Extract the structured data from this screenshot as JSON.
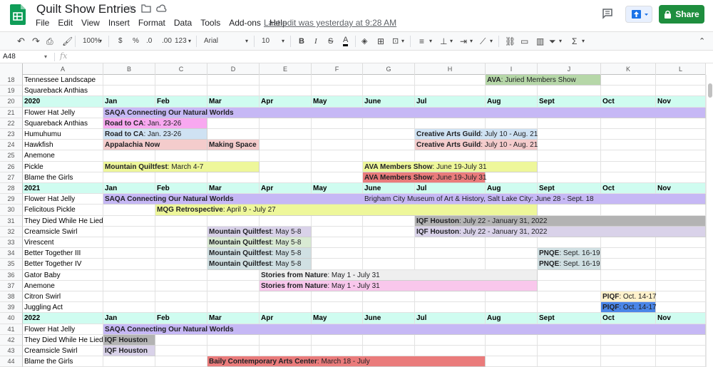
{
  "header": {
    "title": "Quilt Show Entries",
    "last_edit": "Last edit was yesterday at 9:28 AM",
    "share_label": "Share"
  },
  "menu": [
    "File",
    "Edit",
    "View",
    "Insert",
    "Format",
    "Data",
    "Tools",
    "Add-ons",
    "Help"
  ],
  "toolbar": {
    "zoom": "100%",
    "currency": "$",
    "percent": "%",
    "dec_decrease": ".0",
    "dec_increase": ".00",
    "format_more": "123",
    "font": "Arial",
    "font_size": "10",
    "bold": "B",
    "italic": "I",
    "strike": "S",
    "text_color": "A",
    "sigma": "Σ"
  },
  "formula_bar": {
    "cell_ref": "A48",
    "fx": "fx"
  },
  "columns": [
    "A",
    "B",
    "C",
    "D",
    "E",
    "F",
    "G",
    "H",
    "I",
    "J",
    "K",
    "L"
  ],
  "rows": [
    {
      "n": "18",
      "a": "Tennessee Landscape",
      "bands": [
        {
          "col": 8,
          "span": 2,
          "color": "#b6d7a8",
          "bold": "AVA",
          "text": ": Juried Members Show"
        }
      ]
    },
    {
      "n": "19",
      "a": "Squareback Anthias",
      "bands": []
    },
    {
      "n": "20",
      "a": "2020",
      "year": true,
      "months": [
        "Jan",
        "Feb",
        "Mar",
        "Apr",
        "May",
        "June",
        "Jul",
        "Aug",
        "Sept",
        "Oct",
        "Nov"
      ],
      "bands": []
    },
    {
      "n": "21",
      "a": "Flower Hat Jelly",
      "bands": [
        {
          "col": 1,
          "span": 11,
          "color": "#c6b8f5",
          "bold": "SAQA Connecting Our Natural Worlds",
          "text": ""
        }
      ]
    },
    {
      "n": "22",
      "a": "Squareback Anthias",
      "bands": [
        {
          "col": 1,
          "span": 2,
          "color": "#f8a8f0",
          "bold": "Road to CA",
          "text": ": Jan. 23-26"
        }
      ]
    },
    {
      "n": "23",
      "a": "Humuhumu",
      "bands": [
        {
          "col": 1,
          "span": 2,
          "color": "#cfe2f3",
          "bold": "Road to CA",
          "text": ": Jan. 23-26"
        },
        {
          "col": 7,
          "span": 2,
          "color": "#cfe2f3",
          "bold": "Creative Arts Guild",
          "text": ": July 10 - Aug. 21"
        }
      ]
    },
    {
      "n": "24",
      "a": "Hawkfish",
      "bands": [
        {
          "col": 1,
          "span": 2,
          "color": "#f4cccc",
          "bold": "Appalachia Now",
          "text": ""
        },
        {
          "col": 3,
          "span": 1,
          "color": "#f4cccc",
          "bold": "Making Space",
          "text": ""
        },
        {
          "col": 7,
          "span": 2,
          "color": "#f4cccc",
          "bold": "Creative Arts Guild",
          "text": ": July 10 - Aug. 21"
        }
      ]
    },
    {
      "n": "25",
      "a": "Anemone",
      "bands": []
    },
    {
      "n": "26",
      "a": "Pickle",
      "bands": [
        {
          "col": 1,
          "span": 3,
          "color": "#eef79a",
          "bold": "Mountain Quiltfest",
          "text": ": March 4-7"
        },
        {
          "col": 6,
          "span": 3,
          "color": "#eef79a",
          "bold": "AVA Members Show",
          "text": ": June 19-July 31"
        }
      ]
    },
    {
      "n": "27",
      "a": "Blame the Girls",
      "bands": [
        {
          "col": 6,
          "span": 2,
          "color": "#ea7b7b",
          "bold": "AVA Members Show",
          "text": ": June 19-July 31"
        }
      ]
    },
    {
      "n": "28",
      "a": "2021",
      "year": true,
      "months": [
        "Jan",
        "Feb",
        "Mar",
        "Apr",
        "May",
        "June",
        "Jul",
        "Aug",
        "Sept",
        "Oct",
        "Nov"
      ],
      "bands": []
    },
    {
      "n": "29",
      "a": "Flower Hat Jelly",
      "bands": [
        {
          "col": 1,
          "span": 11,
          "color": "#c6b8f5",
          "bold": "SAQA Connecting Our Natural Worlds",
          "text": ""
        },
        {
          "col": 6,
          "span": 0,
          "color": "",
          "bold": "",
          "text": "Brigham City Museum of Art & History, Salt Lake City: June 28 - Sept. 18"
        }
      ]
    },
    {
      "n": "30",
      "a": "Felicitous Pickle",
      "bands": [
        {
          "col": 2,
          "span": 7,
          "color": "#eef79a",
          "bold": "MQG Retrospective",
          "text": ": April 9 - July 27"
        }
      ]
    },
    {
      "n": "31",
      "a": "They Died While He Lied",
      "bands": [
        {
          "col": 7,
          "span": 5,
          "color": "#b3b3b3",
          "bold": "IQF Houston",
          "text": ": July 22 - January 31, 2022"
        }
      ]
    },
    {
      "n": "32",
      "a": "Creamsicle Swirl",
      "bands": [
        {
          "col": 3,
          "span": 2,
          "color": "#d9d2e9",
          "bold": "Mountain Quiltfest",
          "text": ": May 5-8"
        },
        {
          "col": 7,
          "span": 5,
          "color": "#d9d2e9",
          "bold": "IQF Houston",
          "text": ": July 22 - January 31, 2022"
        }
      ]
    },
    {
      "n": "33",
      "a": "Virescent",
      "bands": [
        {
          "col": 3,
          "span": 2,
          "color": "#d9ead3",
          "bold": "Mountain Quiltfest",
          "text": ": May 5-8"
        }
      ]
    },
    {
      "n": "34",
      "a": "Better Together III",
      "bands": [
        {
          "col": 3,
          "span": 2,
          "color": "#d0e0e3",
          "bold": "Mountain Quiltfest",
          "text": ": May 5-8"
        },
        {
          "col": 9,
          "span": 1,
          "color": "#d0e0e3",
          "bold": "PNQE",
          "text": ": Sept. 16-19"
        }
      ]
    },
    {
      "n": "35",
      "a": "Better Together IV",
      "bands": [
        {
          "col": 3,
          "span": 2,
          "color": "#d0e0e3",
          "bold": "Mountain Quiltfest",
          "text": ": May 5-8"
        },
        {
          "col": 9,
          "span": 1,
          "color": "#d0e0e3",
          "bold": "PNQE",
          "text": ": Sept. 16-19"
        }
      ]
    },
    {
      "n": "36",
      "a": "Gator Baby",
      "bands": [
        {
          "col": 4,
          "span": 5,
          "color": "#efefef",
          "bold": "Stories from Nature",
          "text": ": May 1 - July 31"
        }
      ]
    },
    {
      "n": "37",
      "a": "Anemone",
      "bands": [
        {
          "col": 4,
          "span": 5,
          "color": "#f9c7ec",
          "bold": "Stories from Nature",
          "text": ": May 1 - July 31"
        }
      ]
    },
    {
      "n": "38",
      "a": "Citron Swirl",
      "bands": [
        {
          "col": 10,
          "span": 1,
          "color": "#fff2cc",
          "bold": "PIQF",
          "text": ": Oct. 14-17"
        }
      ]
    },
    {
      "n": "39",
      "a": "Juggling Act",
      "bands": [
        {
          "col": 10,
          "span": 1,
          "color": "#4a86e8",
          "bold": "PIQF",
          "text": ": Oct. 14-17"
        }
      ]
    },
    {
      "n": "40",
      "a": "2022",
      "year": true,
      "months": [
        "Jan",
        "Feb",
        "Mar",
        "Apr",
        "May",
        "June",
        "Jul",
        "Aug",
        "Sept",
        "Oct",
        "Nov"
      ],
      "bands": []
    },
    {
      "n": "41",
      "a": "Flower Hat Jelly",
      "bands": [
        {
          "col": 1,
          "span": 11,
          "color": "#c6b8f5",
          "bold": "SAQA Connecting Our Natural Worlds",
          "text": ""
        }
      ]
    },
    {
      "n": "42",
      "a": "They Died While He Lied",
      "bands": [
        {
          "col": 1,
          "span": 1,
          "color": "#b3b3b3",
          "bold": "IQF Houston",
          "text": ""
        }
      ]
    },
    {
      "n": "43",
      "a": "Creamsicle Swirl",
      "bands": [
        {
          "col": 1,
          "span": 1,
          "color": "#d9d2e9",
          "bold": "IQF Houston",
          "text": ""
        }
      ]
    },
    {
      "n": "44",
      "a": "Blame the Girls",
      "bands": [
        {
          "col": 3,
          "span": 5,
          "color": "#ea7b7b",
          "bold": "Baily Contemporary Arts Center",
          "text": ": March 18 - July"
        }
      ]
    }
  ],
  "colors": {
    "share": "#1e8e3e",
    "year_row": "#cffcf0",
    "sheets_green": "#0f9d58"
  }
}
